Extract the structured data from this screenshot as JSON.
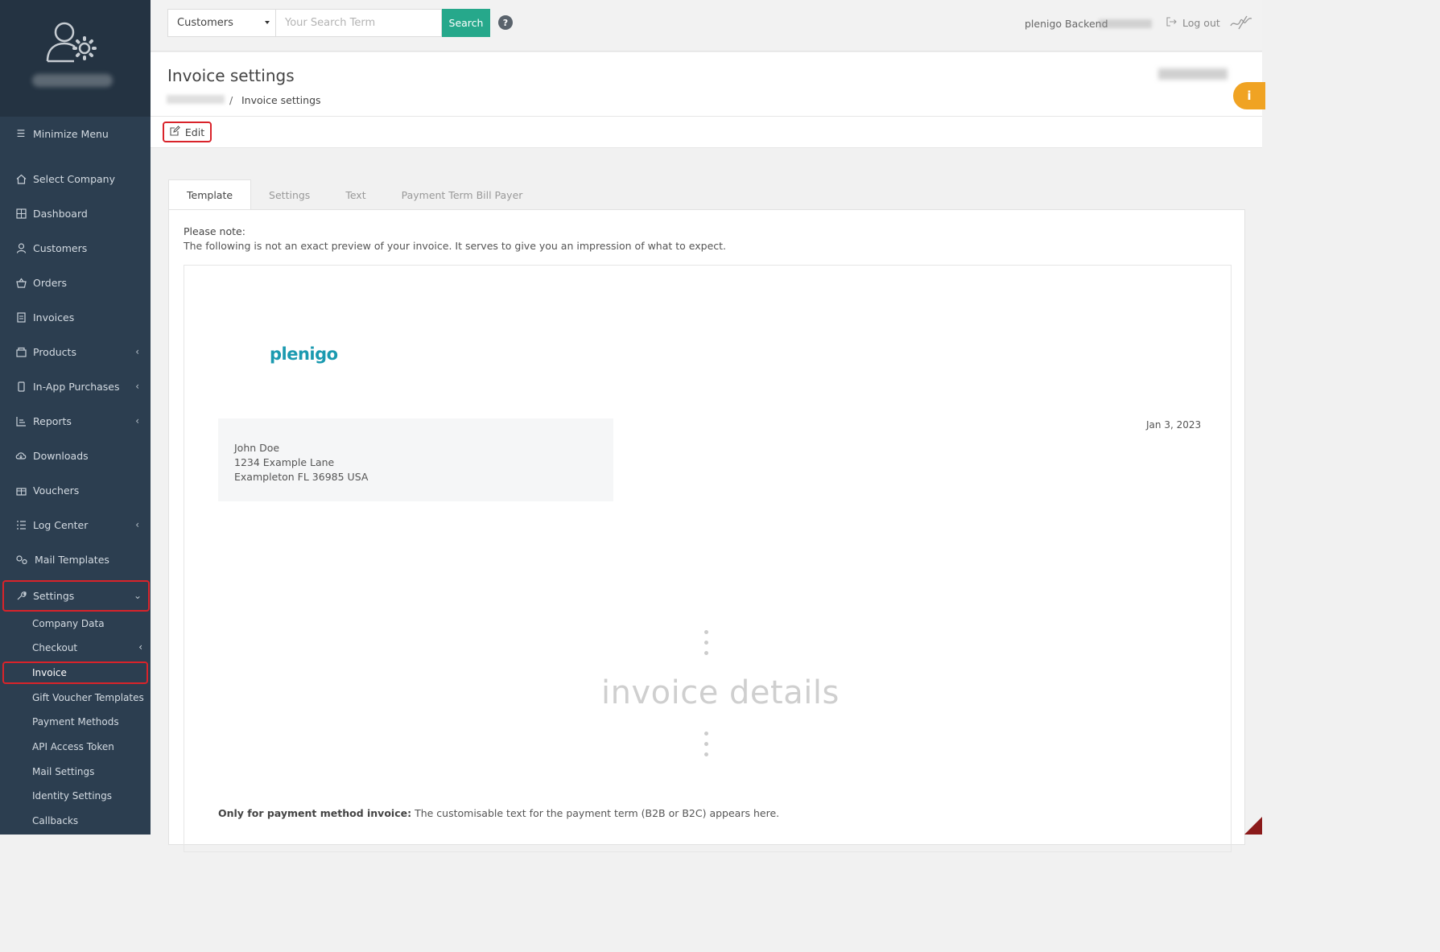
{
  "sidebar": {
    "minimize": "Minimize Menu",
    "items": [
      {
        "label": "Select Company",
        "icon": "home-icon"
      },
      {
        "label": "Dashboard",
        "icon": "grid-icon"
      },
      {
        "label": "Customers",
        "icon": "user-icon"
      },
      {
        "label": "Orders",
        "icon": "basket-icon"
      },
      {
        "label": "Invoices",
        "icon": "document-icon"
      },
      {
        "label": "Products",
        "icon": "box-icon"
      },
      {
        "label": "In-App Purchases",
        "icon": "phone-icon"
      },
      {
        "label": "Reports",
        "icon": "chart-icon"
      },
      {
        "label": "Downloads",
        "icon": "cloud-download-icon"
      },
      {
        "label": "Vouchers",
        "icon": "gift-icon"
      },
      {
        "label": "Log Center",
        "icon": "list-icon"
      },
      {
        "label": "Mail Templates",
        "icon": "cogs-icon"
      },
      {
        "label": "Settings",
        "icon": "wrench-icon"
      }
    ],
    "sub_items": [
      "Company Data",
      "Checkout",
      "Invoice",
      "Gift Voucher Templates",
      "Payment Methods",
      "API Access Token",
      "Mail Settings",
      "Identity Settings",
      "Callbacks"
    ]
  },
  "topbar": {
    "search_scope": "Customers",
    "search_placeholder": "Your Search Term",
    "search_button": "Search",
    "help": "?",
    "user_label": "plenigo Backend",
    "logout": "Log out"
  },
  "header": {
    "title": "Invoice settings",
    "breadcrumb_separator": "/",
    "breadcrumb_current": "Invoice settings",
    "info": "i"
  },
  "toolbar": {
    "edit": "Edit"
  },
  "tabs": [
    "Template",
    "Settings",
    "Text",
    "Payment Term Bill Payer"
  ],
  "panel": {
    "note_title": "Please note:",
    "note_text": "The following is not an exact preview of your invoice. It serves to give you an impression of what to expect.",
    "logo_text": "plenigo",
    "address": [
      "John Doe",
      "1234 Example Lane",
      "Exampleton FL 36985 USA"
    ],
    "date": "Jan 3, 2023",
    "details_placeholder": "invoice details",
    "payterm_bold": "Only for payment method invoice:",
    "payterm_text": " The customisable text for the payment term (B2B or B2C) appears here."
  },
  "colors": {
    "sidebar_bg": "#2c3e50",
    "accent_green": "#26a88b",
    "highlight_red": "#d9232a",
    "info_orange": "#f0a323",
    "logo_teal": "#1b9ab0"
  }
}
